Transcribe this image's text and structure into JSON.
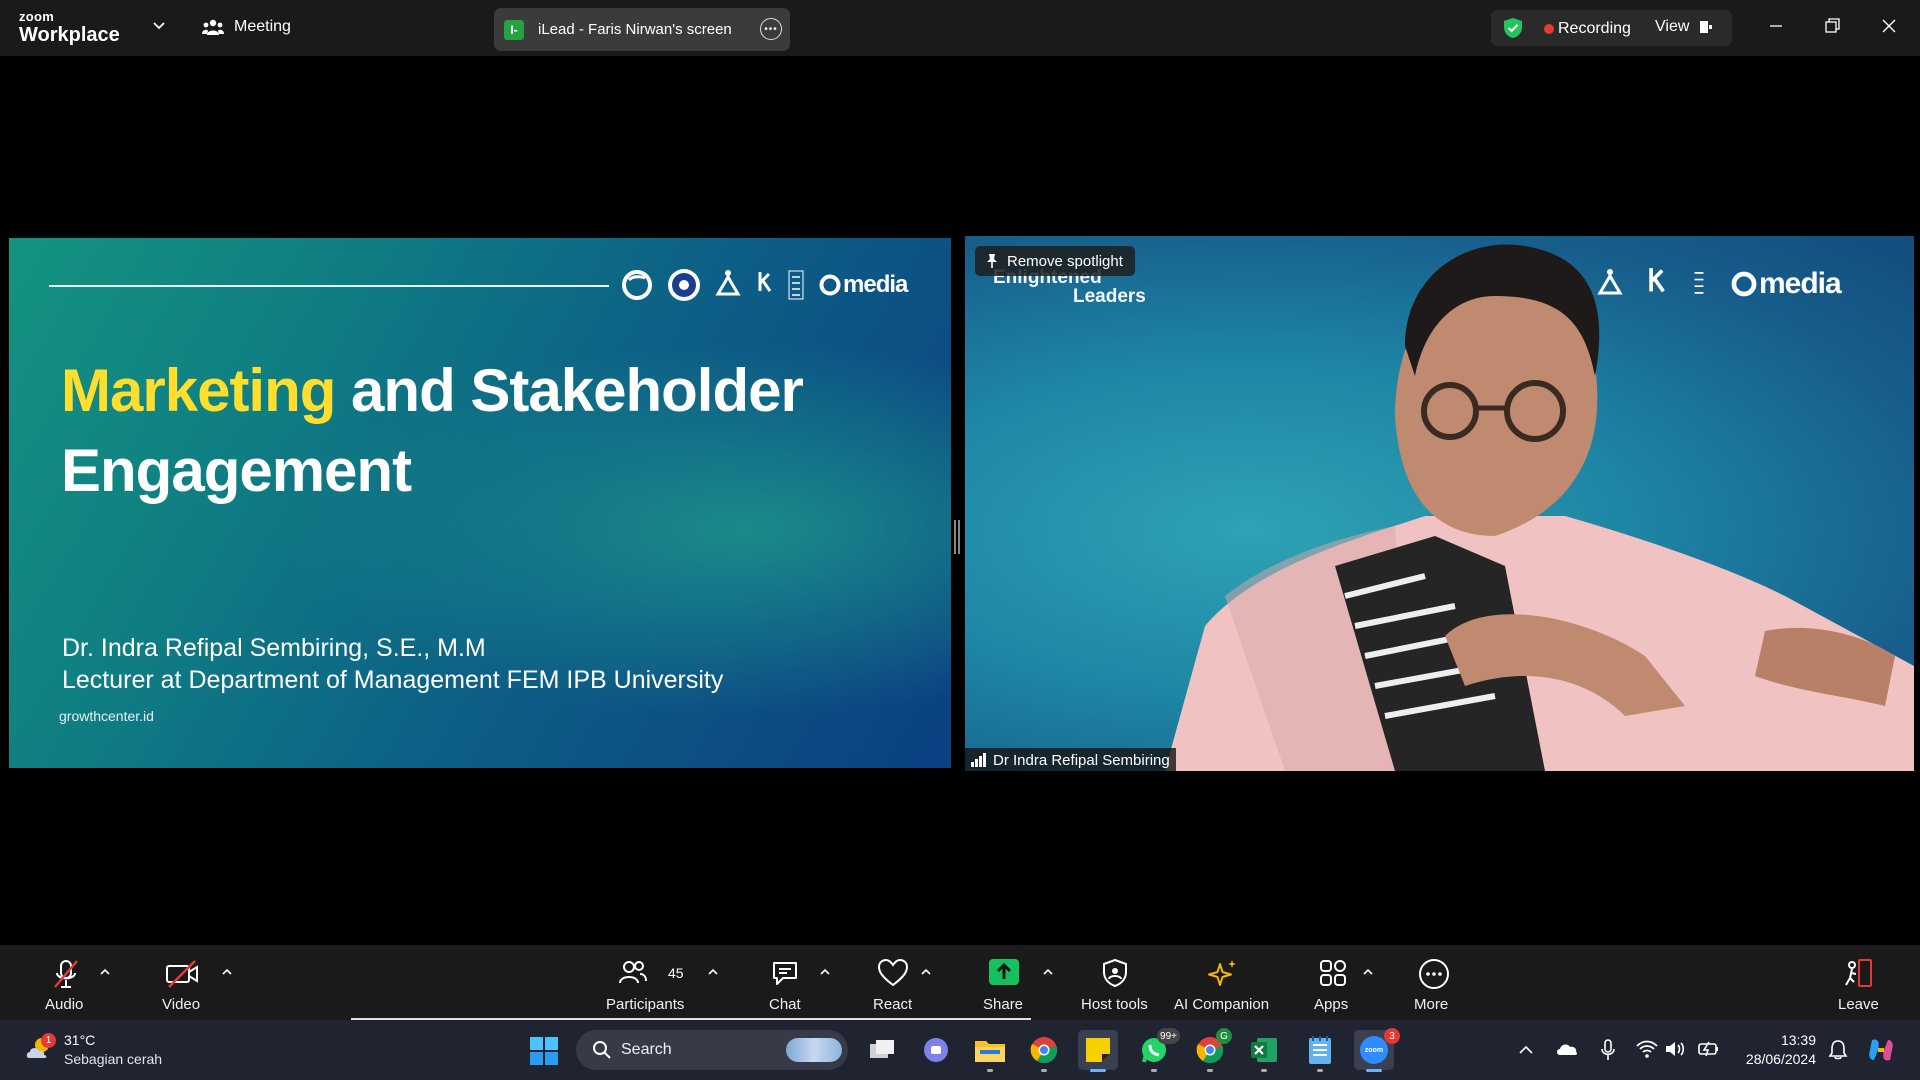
{
  "app": {
    "brand_small": "zoom",
    "brand_big": "Workplace",
    "meeting_label": "Meeting"
  },
  "screen_share": {
    "badge": "I-",
    "label": "iLead - Faris Nirwan's screen"
  },
  "status": {
    "recording": "Recording",
    "view": "View"
  },
  "slide": {
    "title_highlight": "Marketing",
    "title_rest": " and Stakeholder",
    "title_line2": "Engagement",
    "presenter_name": "Dr. Indra Refipal Sembiring, S.E., M.M",
    "presenter_role": "Lecturer at Department of Management FEM IPB University",
    "website": "growthcenter.id",
    "logo_text": "media",
    "colors": {
      "highlight": "#ffde2d"
    }
  },
  "video": {
    "spotlight_button": "Remove spotlight",
    "background_text_1": "Enlightened",
    "background_text_2": "Leaders",
    "logo_text": "media",
    "participant_name": "Dr Indra Refipal Sembiring"
  },
  "toolbar": {
    "audio": "Audio",
    "video": "Video",
    "participants": "Participants",
    "participants_count": "45",
    "chat": "Chat",
    "react": "React",
    "share": "Share",
    "host_tools": "Host tools",
    "ai_companion": "AI Companion",
    "apps": "Apps",
    "more": "More",
    "leave": "Leave"
  },
  "taskbar": {
    "weather_badge": "1",
    "temperature": "31°C",
    "condition": "Sebagian cerah",
    "search": "Search",
    "whatsapp_badge": "99+",
    "zoom_badge": "3",
    "chrome_profile": "G",
    "zoom_label": "zoom",
    "time": "13:39",
    "date": "28/06/2024"
  }
}
